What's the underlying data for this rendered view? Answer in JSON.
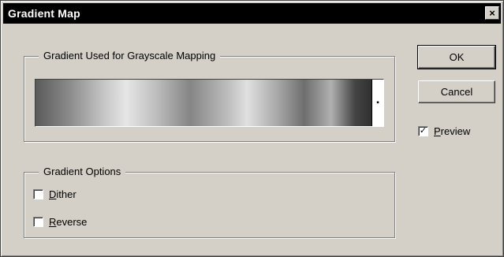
{
  "window": {
    "title": "Gradient Map",
    "close_glyph": "×"
  },
  "gradient_group": {
    "label": "Gradient Used for Grayscale Mapping",
    "dropdown_glyph": "▪"
  },
  "options_group": {
    "label": "Gradient Options",
    "dither": {
      "first": "D",
      "rest": "ither",
      "checked": false
    },
    "reverse": {
      "first": "R",
      "rest": "everse",
      "checked": false
    }
  },
  "buttons": {
    "ok": "OK",
    "cancel": "Cancel"
  },
  "preview": {
    "first": "P",
    "rest": "review",
    "checked": true,
    "check_glyph": "✓"
  },
  "colors": {
    "dialog_bg": "#d4d0c8",
    "titlebar_bg": "#000000",
    "titlebar_text": "#ffffff"
  },
  "icons": {
    "close": "close-icon",
    "dropdown": "chevron-down-icon",
    "check": "checkmark-icon"
  }
}
